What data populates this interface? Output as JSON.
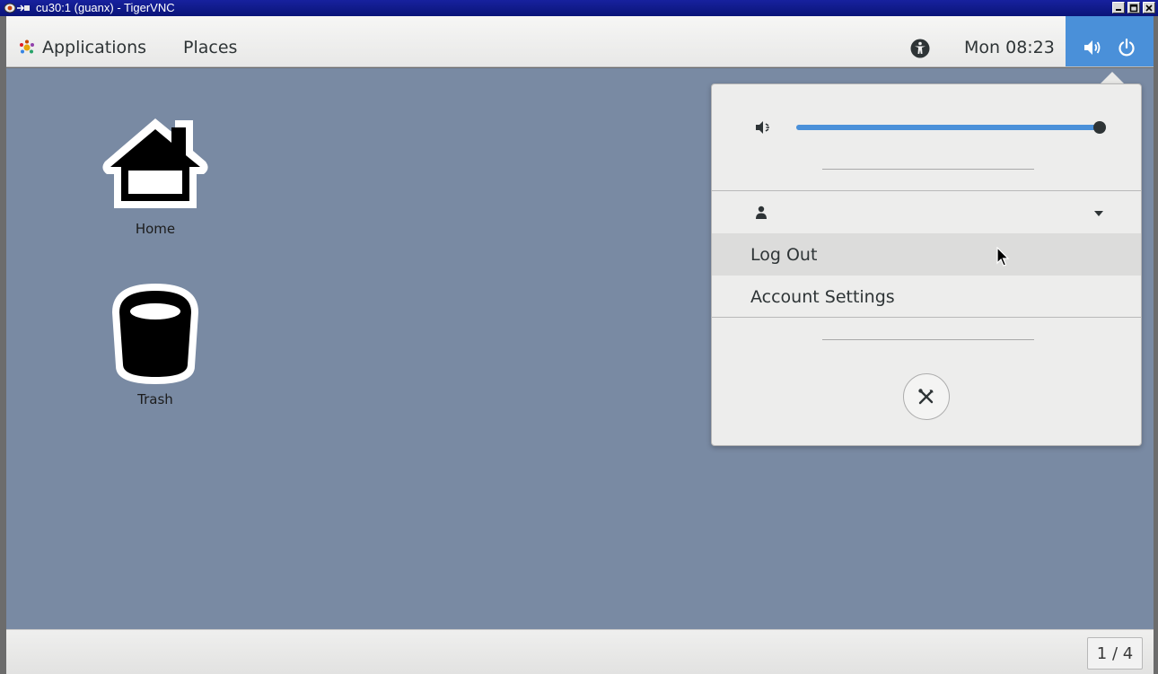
{
  "window": {
    "title": "cu30:1 (guanx) - TigerVNC"
  },
  "topbar": {
    "applications_label": "Applications",
    "places_label": "Places",
    "clock": "Mon 08:23"
  },
  "desktop": {
    "icons": [
      {
        "label": "Home"
      },
      {
        "label": "Trash"
      }
    ]
  },
  "system_menu": {
    "volume_level_percent": 100,
    "user_name": "",
    "items": [
      {
        "label": "Log Out",
        "hovered": true
      },
      {
        "label": "Account Settings",
        "hovered": false
      }
    ]
  },
  "bottombar": {
    "workspace_indicator": "1 / 4"
  },
  "colors": {
    "desktop_background": "#798aa3",
    "status_area_accent": "#4a90d9",
    "vnc_titlebar": "#0f1a8c"
  },
  "icons": [
    "vnc-app-icon",
    "minimize-icon",
    "maximize-icon",
    "close-icon",
    "gnome-foot-icon",
    "accessibility-icon",
    "volume-icon",
    "power-icon",
    "home-folder-icon",
    "trash-icon",
    "volume-muted-icon",
    "user-icon",
    "chevron-down-icon",
    "settings-tools-icon",
    "mouse-pointer-icon"
  ]
}
